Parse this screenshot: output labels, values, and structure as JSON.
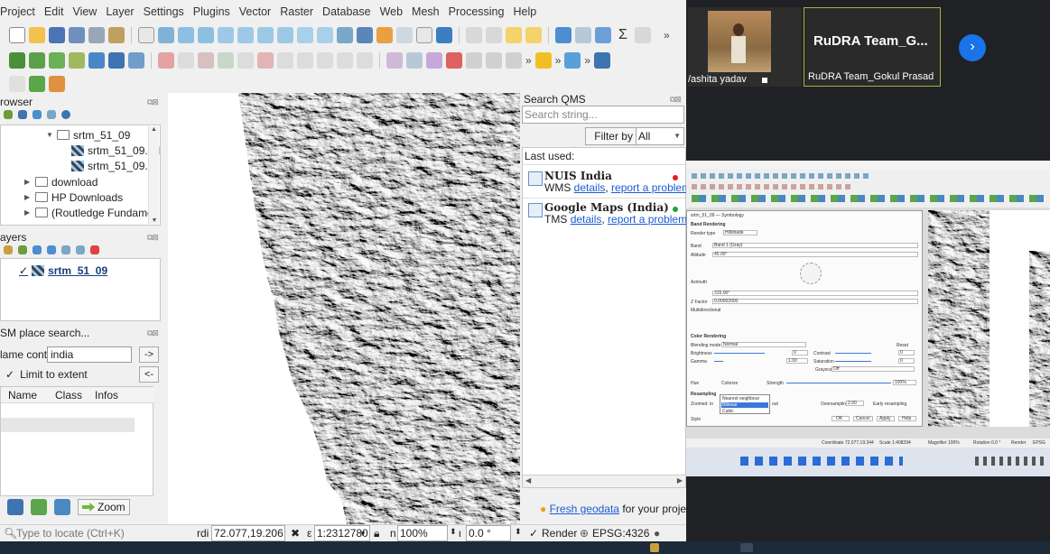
{
  "menubar": [
    "Project",
    "Edit",
    "View",
    "Layer",
    "Settings",
    "Plugins",
    "Vector",
    "Raster",
    "Database",
    "Web",
    "Mesh",
    "Processing",
    "Help"
  ],
  "browser": {
    "title": "rowser",
    "items": [
      {
        "label": "srtm_51_09",
        "kind": "folder-open"
      },
      {
        "label": "srtm_51_09.hd",
        "kind": "raster"
      },
      {
        "label": "srtm_51_09.tif",
        "kind": "raster"
      },
      {
        "label": "download",
        "kind": "folder"
      },
      {
        "label": "HP Downloads",
        "kind": "folder"
      },
      {
        "label": "(Routledge Fundamen",
        "kind": "folder"
      }
    ]
  },
  "layers": {
    "title": "ayers",
    "items": [
      {
        "label": "srtm_51_09",
        "checked": true
      }
    ]
  },
  "osm": {
    "title": "SM place search...",
    "name_label": "lame contains...",
    "name_value": "india",
    "search_btn": "->",
    "limit_label": "Limit to extent",
    "clear_btn": "<-",
    "columns": [
      "Name",
      "Class",
      "Infos"
    ]
  },
  "zoom_btn": "Zoom",
  "locator_placeholder": "Type to locate (Ctrl+K)",
  "qms": {
    "title": "Search QMS",
    "search_placeholder": "Search string...",
    "filter_label": "Filter by extent",
    "filter_value": "All",
    "last_used_label": "Last used:",
    "items": [
      {
        "name": "NUIS India",
        "type": "WMS",
        "details": "details",
        "report": "report a problem",
        "status_color": "#e31b1b"
      },
      {
        "name": "Google Maps (India)",
        "type": "TMS",
        "details": "details",
        "report": "report a problem",
        "status_color": "#22a33a"
      }
    ],
    "fresh_link": "Fresh geodata",
    "fresh_tail": "for your project"
  },
  "status": {
    "coord_label": "rdi",
    "coordinate": "72.077,19.206",
    "scale_label": "ε",
    "scale": "1:2312780",
    "magnifier_label": "n",
    "magnifier": "100%",
    "rotation_label": "ι",
    "rotation": "0.0 °",
    "render_label": "Render",
    "crs": "EPSG:4326"
  },
  "call": {
    "tile1_name": "/ashita yadav",
    "tile2_big": "RuDRA  Team_G...",
    "tile2_name": "RuDRA Team_Gokul Prasad"
  },
  "share": {
    "dialog_title": "srtm_51_09 — Symbology",
    "band_rendering": "Band Rendering",
    "render_type": "Render type",
    "render_value": "Hillshade",
    "band_label": "Band",
    "band_value": "Band 1 (Gray)",
    "altitude_label": "Altitude",
    "altitude_value": "45.00°",
    "azimuth_label": "Azimuth",
    "azimuth_value": "315.00°",
    "zfactor_label": "Z Factor",
    "zfactor_value": "0.00002000",
    "multidir_label": "Multidirectional",
    "color_rendering": "Color Rendering",
    "blending_label": "Blending mode",
    "blending_value": "Normal",
    "reset_label": "Reset",
    "brightness_label": "Brightness",
    "brightness_value": "0",
    "contrast_label": "Contrast",
    "contrast_value": "0",
    "gamma_label": "Gamma",
    "gamma_value": "1.00",
    "saturation_label": "Saturation",
    "saturation_value": "0",
    "grayscale_label": "Grayscale",
    "grayscale_value": "Off",
    "hue_label": "Hue",
    "colorize_label": "Colorize",
    "strength_label": "Strength",
    "strength_value": "100%",
    "resampling": "Resampling",
    "zoomed_in_label": "Zoomed: in",
    "zoomed_out_label": "out",
    "oversampling_label": "Oversampling",
    "oversampling_value": "2.00",
    "early_label": "Early resampling",
    "resample_options": [
      "Nearest neighbour",
      "Bilinear",
      "Cubic"
    ],
    "style_label": "Style",
    "ok": "OK",
    "cancel": "Cancel",
    "apply": "Apply",
    "help": "Help",
    "status_coord": "Coordinate  72.077,19.344",
    "status_scale": "Scale  1:408294",
    "status_mag": "Magnifier  100%",
    "status_rot": "Rotation  0.0 °",
    "status_render": "Render",
    "status_crs": "EPSG"
  }
}
